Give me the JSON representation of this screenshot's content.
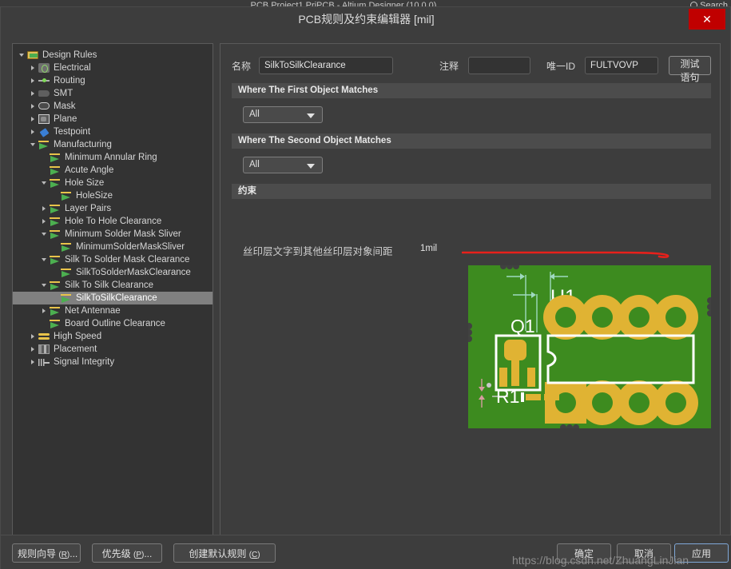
{
  "background": {
    "app_title": "PCB Project1.PrjPCB - Altium Designer  (10.0.0)",
    "search_label": "Search"
  },
  "dialog": {
    "title": "PCB规则及约束编辑器 [mil]",
    "close_label": "✕"
  },
  "tree": {
    "items": [
      {
        "label": "Design Rules",
        "depth": 0,
        "icon": "folder-icon",
        "twisty": "expanded",
        "selected": false
      },
      {
        "label": "Electrical",
        "depth": 1,
        "icon": "electrical-icon",
        "twisty": "collapsed",
        "selected": false
      },
      {
        "label": "Routing",
        "depth": 1,
        "icon": "routing-icon",
        "twisty": "collapsed",
        "selected": false
      },
      {
        "label": "SMT",
        "depth": 1,
        "icon": "smt-icon",
        "twisty": "collapsed",
        "selected": false
      },
      {
        "label": "Mask",
        "depth": 1,
        "icon": "mask-icon",
        "twisty": "collapsed",
        "selected": false
      },
      {
        "label": "Plane",
        "depth": 1,
        "icon": "plane-icon",
        "twisty": "collapsed",
        "selected": false
      },
      {
        "label": "Testpoint",
        "depth": 1,
        "icon": "testpoint-icon",
        "twisty": "collapsed",
        "selected": false
      },
      {
        "label": "Manufacturing",
        "depth": 1,
        "icon": "manufacturing-icon",
        "twisty": "expanded",
        "selected": false
      },
      {
        "label": "Minimum Annular Ring",
        "depth": 2,
        "icon": "rule-icon",
        "twisty": "none",
        "selected": false
      },
      {
        "label": "Acute Angle",
        "depth": 2,
        "icon": "rule-icon",
        "twisty": "none",
        "selected": false
      },
      {
        "label": "Hole Size",
        "depth": 2,
        "icon": "rule-icon",
        "twisty": "expanded",
        "selected": false
      },
      {
        "label": "HoleSize",
        "depth": 3,
        "icon": "rule-icon",
        "twisty": "none",
        "selected": false
      },
      {
        "label": "Layer Pairs",
        "depth": 2,
        "icon": "rule-icon",
        "twisty": "collapsed",
        "selected": false
      },
      {
        "label": "Hole To Hole Clearance",
        "depth": 2,
        "icon": "rule-icon",
        "twisty": "collapsed",
        "selected": false
      },
      {
        "label": "Minimum Solder Mask Sliver",
        "depth": 2,
        "icon": "rule-icon",
        "twisty": "expanded",
        "selected": false
      },
      {
        "label": "MinimumSolderMaskSliver",
        "depth": 3,
        "icon": "rule-icon",
        "twisty": "none",
        "selected": false
      },
      {
        "label": "Silk To Solder Mask Clearance",
        "depth": 2,
        "icon": "rule-icon",
        "twisty": "expanded",
        "selected": false
      },
      {
        "label": "SilkToSolderMaskClearance",
        "depth": 3,
        "icon": "rule-icon",
        "twisty": "none",
        "selected": false
      },
      {
        "label": "Silk To Silk Clearance",
        "depth": 2,
        "icon": "rule-icon",
        "twisty": "expanded",
        "selected": false
      },
      {
        "label": "SilkToSilkClearance",
        "depth": 3,
        "icon": "rule-icon",
        "twisty": "none",
        "selected": true
      },
      {
        "label": "Net Antennae",
        "depth": 2,
        "icon": "rule-icon",
        "twisty": "collapsed",
        "selected": false
      },
      {
        "label": "Board Outline Clearance",
        "depth": 2,
        "icon": "rule-icon",
        "twisty": "none",
        "selected": false
      },
      {
        "label": "High Speed",
        "depth": 1,
        "icon": "highspeed-icon",
        "twisty": "collapsed",
        "selected": false
      },
      {
        "label": "Placement",
        "depth": 1,
        "icon": "placement-icon",
        "twisty": "collapsed",
        "selected": false
      },
      {
        "label": "Signal Integrity",
        "depth": 1,
        "icon": "signal-integrity-icon",
        "twisty": "collapsed",
        "selected": false
      }
    ]
  },
  "form": {
    "name_label": "名称",
    "name_value": "SilkToSilkClearance",
    "comment_label": "注释",
    "comment_value": "",
    "comment_placeholder": "",
    "unique_id_label": "唯一ID",
    "unique_id_value": "FULTVOVP",
    "test_query_button": "测试语句"
  },
  "sections": {
    "first_object": {
      "title": "Where The First Object Matches",
      "scope_value": "All"
    },
    "second_object": {
      "title": "Where The Second Object Matches",
      "scope_value": "All"
    },
    "constraints": {
      "title": "约束",
      "clearance_label": "丝印层文字到其他丝印层对象间距",
      "clearance_value": "1mil"
    }
  },
  "pcb_preview": {
    "designators": [
      "U1",
      "Q1",
      "R1"
    ],
    "board_color": "#3d8b1f",
    "pad_color": "#e0b333",
    "silk_color": "#ffffff",
    "dimension_color": "#9fd9c0"
  },
  "footer": {
    "left_buttons": [
      {
        "text": "规则向导 ",
        "key": "R",
        "suffix": "..."
      },
      {
        "text": "优先级 ",
        "key": "P",
        "suffix": "..."
      },
      {
        "text": "创建默认规则 ",
        "key": "C",
        "suffix": ""
      }
    ],
    "right_buttons": [
      {
        "label": "确定",
        "primary": false
      },
      {
        "label": "取消",
        "primary": false
      },
      {
        "label": "应用",
        "primary": true
      }
    ]
  },
  "watermark": "https://blog.csdn.net/ZhuangLinJian"
}
